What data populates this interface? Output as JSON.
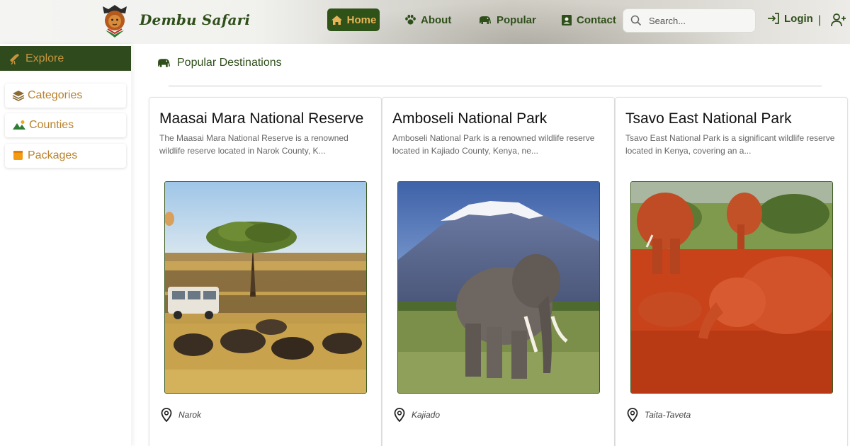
{
  "brand": {
    "name": "Dembu Safari"
  },
  "nav": {
    "home": "Home",
    "about": "About",
    "popular": "Popular",
    "contact": "Contact",
    "search_placeholder": "Search...",
    "login": "Login",
    "separator": "|"
  },
  "sidebar": {
    "explore": "Explore",
    "items": [
      {
        "label": "Categories",
        "icon": "layers-icon"
      },
      {
        "label": "Counties",
        "icon": "landscape-icon"
      },
      {
        "label": "Packages",
        "icon": "package-icon"
      }
    ]
  },
  "main": {
    "section_title": "Popular Destinations",
    "cards": [
      {
        "title": "Maasai Mara National Reserve",
        "description": "The Maasai Mara National Reserve is a renowned wildlife reserve located in Narok County, K...",
        "location": "Narok"
      },
      {
        "title": "Amboseli National Park",
        "description": "Amboseli National Park is a renowned wildlife reserve located in Kajiado County, Kenya, ne...",
        "location": "Kajiado"
      },
      {
        "title": "Tsavo East National Park",
        "description": "Tsavo East National Park is a significant wildlife reserve located in Kenya, covering an a...",
        "location": "Taita-Taveta"
      }
    ]
  },
  "colors": {
    "primary_green": "#2f4f1a",
    "accent_gold": "#e8b457",
    "sidebar_text": "#b8822e"
  }
}
